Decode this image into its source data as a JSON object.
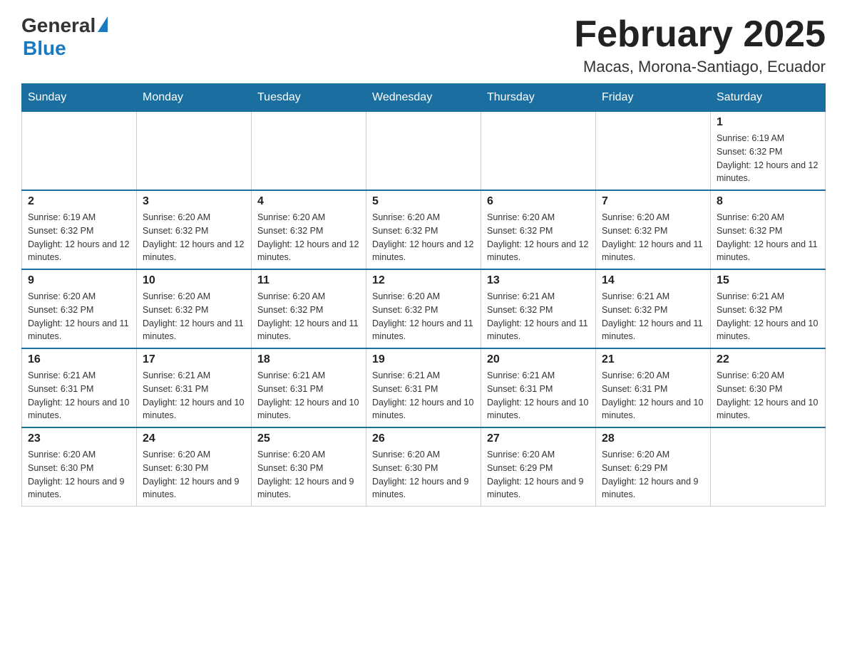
{
  "logo": {
    "general": "General",
    "blue": "Blue"
  },
  "header": {
    "month": "February 2025",
    "location": "Macas, Morona-Santiago, Ecuador"
  },
  "weekdays": [
    "Sunday",
    "Monday",
    "Tuesday",
    "Wednesday",
    "Thursday",
    "Friday",
    "Saturday"
  ],
  "weeks": [
    [
      {
        "day": "",
        "info": ""
      },
      {
        "day": "",
        "info": ""
      },
      {
        "day": "",
        "info": ""
      },
      {
        "day": "",
        "info": ""
      },
      {
        "day": "",
        "info": ""
      },
      {
        "day": "",
        "info": ""
      },
      {
        "day": "1",
        "info": "Sunrise: 6:19 AM\nSunset: 6:32 PM\nDaylight: 12 hours and 12 minutes."
      }
    ],
    [
      {
        "day": "2",
        "info": "Sunrise: 6:19 AM\nSunset: 6:32 PM\nDaylight: 12 hours and 12 minutes."
      },
      {
        "day": "3",
        "info": "Sunrise: 6:20 AM\nSunset: 6:32 PM\nDaylight: 12 hours and 12 minutes."
      },
      {
        "day": "4",
        "info": "Sunrise: 6:20 AM\nSunset: 6:32 PM\nDaylight: 12 hours and 12 minutes."
      },
      {
        "day": "5",
        "info": "Sunrise: 6:20 AM\nSunset: 6:32 PM\nDaylight: 12 hours and 12 minutes."
      },
      {
        "day": "6",
        "info": "Sunrise: 6:20 AM\nSunset: 6:32 PM\nDaylight: 12 hours and 12 minutes."
      },
      {
        "day": "7",
        "info": "Sunrise: 6:20 AM\nSunset: 6:32 PM\nDaylight: 12 hours and 11 minutes."
      },
      {
        "day": "8",
        "info": "Sunrise: 6:20 AM\nSunset: 6:32 PM\nDaylight: 12 hours and 11 minutes."
      }
    ],
    [
      {
        "day": "9",
        "info": "Sunrise: 6:20 AM\nSunset: 6:32 PM\nDaylight: 12 hours and 11 minutes."
      },
      {
        "day": "10",
        "info": "Sunrise: 6:20 AM\nSunset: 6:32 PM\nDaylight: 12 hours and 11 minutes."
      },
      {
        "day": "11",
        "info": "Sunrise: 6:20 AM\nSunset: 6:32 PM\nDaylight: 12 hours and 11 minutes."
      },
      {
        "day": "12",
        "info": "Sunrise: 6:20 AM\nSunset: 6:32 PM\nDaylight: 12 hours and 11 minutes."
      },
      {
        "day": "13",
        "info": "Sunrise: 6:21 AM\nSunset: 6:32 PM\nDaylight: 12 hours and 11 minutes."
      },
      {
        "day": "14",
        "info": "Sunrise: 6:21 AM\nSunset: 6:32 PM\nDaylight: 12 hours and 11 minutes."
      },
      {
        "day": "15",
        "info": "Sunrise: 6:21 AM\nSunset: 6:32 PM\nDaylight: 12 hours and 10 minutes."
      }
    ],
    [
      {
        "day": "16",
        "info": "Sunrise: 6:21 AM\nSunset: 6:31 PM\nDaylight: 12 hours and 10 minutes."
      },
      {
        "day": "17",
        "info": "Sunrise: 6:21 AM\nSunset: 6:31 PM\nDaylight: 12 hours and 10 minutes."
      },
      {
        "day": "18",
        "info": "Sunrise: 6:21 AM\nSunset: 6:31 PM\nDaylight: 12 hours and 10 minutes."
      },
      {
        "day": "19",
        "info": "Sunrise: 6:21 AM\nSunset: 6:31 PM\nDaylight: 12 hours and 10 minutes."
      },
      {
        "day": "20",
        "info": "Sunrise: 6:21 AM\nSunset: 6:31 PM\nDaylight: 12 hours and 10 minutes."
      },
      {
        "day": "21",
        "info": "Sunrise: 6:20 AM\nSunset: 6:31 PM\nDaylight: 12 hours and 10 minutes."
      },
      {
        "day": "22",
        "info": "Sunrise: 6:20 AM\nSunset: 6:30 PM\nDaylight: 12 hours and 10 minutes."
      }
    ],
    [
      {
        "day": "23",
        "info": "Sunrise: 6:20 AM\nSunset: 6:30 PM\nDaylight: 12 hours and 9 minutes."
      },
      {
        "day": "24",
        "info": "Sunrise: 6:20 AM\nSunset: 6:30 PM\nDaylight: 12 hours and 9 minutes."
      },
      {
        "day": "25",
        "info": "Sunrise: 6:20 AM\nSunset: 6:30 PM\nDaylight: 12 hours and 9 minutes."
      },
      {
        "day": "26",
        "info": "Sunrise: 6:20 AM\nSunset: 6:30 PM\nDaylight: 12 hours and 9 minutes."
      },
      {
        "day": "27",
        "info": "Sunrise: 6:20 AM\nSunset: 6:29 PM\nDaylight: 12 hours and 9 minutes."
      },
      {
        "day": "28",
        "info": "Sunrise: 6:20 AM\nSunset: 6:29 PM\nDaylight: 12 hours and 9 minutes."
      },
      {
        "day": "",
        "info": ""
      }
    ]
  ]
}
